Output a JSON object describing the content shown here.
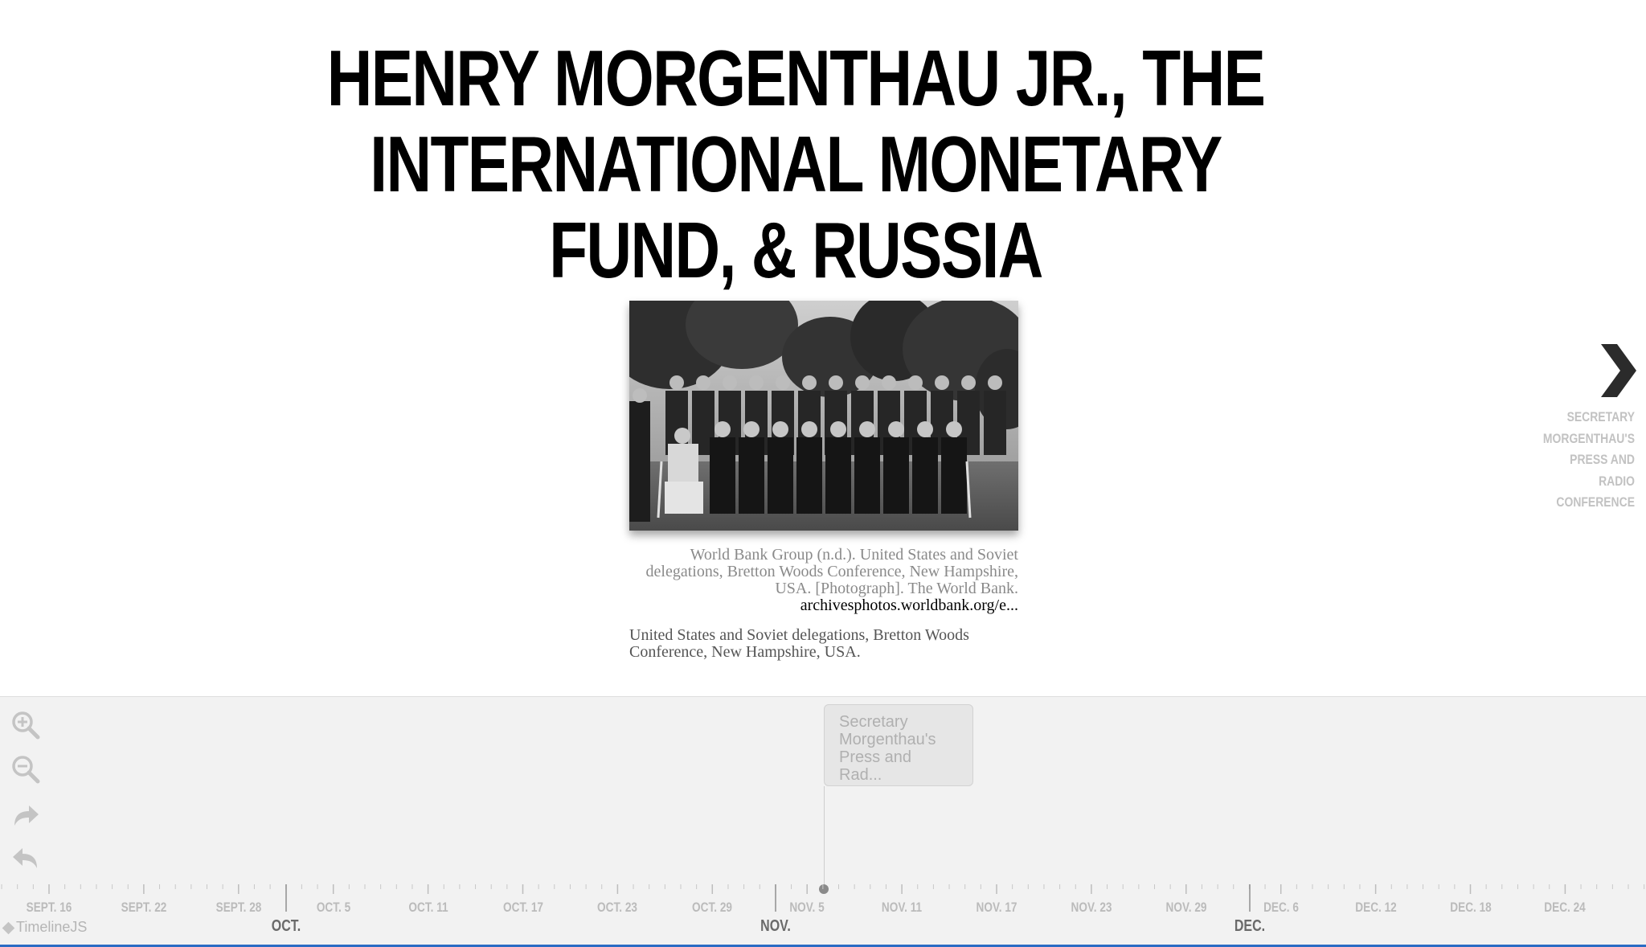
{
  "slide": {
    "title": "HENRY MORGENTHAU JR., THE INTERNATIONAL MONETARY FUND, & RUSSIA",
    "media_credit": "World Bank Group (n.d.). United States and Soviet delegations, Bretton Woods Conference, New Hampshire, USA. [Photograph]. The World Bank.",
    "media_link": "archivesphotos.worldbank.org/e...",
    "media_caption": "United States and Soviet delegations, Bretton Woods Conference, New Hampshire, USA."
  },
  "next_slide": {
    "icon": "chevron-right-icon",
    "label": "SECRETARY MORGENTHAU'S PRESS AND RADIO CONFERENCE"
  },
  "timeline": {
    "tools": [
      {
        "name": "zoom-in",
        "icon": "zoom-in-icon"
      },
      {
        "name": "zoom-out",
        "icon": "zoom-out-icon"
      },
      {
        "name": "forward",
        "icon": "redo-arrow-icon"
      },
      {
        "name": "back-to-start",
        "icon": "undo-arrow-icon"
      }
    ],
    "marker": {
      "text": "Secretary Morgenthau's Press and Rad..."
    },
    "minor_ticks": [
      "SEPT. 16",
      "SEPT. 22",
      "SEPT. 28",
      "OCT. 5",
      "OCT. 11",
      "OCT. 17",
      "OCT. 23",
      "OCT. 29",
      "NOV. 5",
      "NOV. 11",
      "NOV. 17",
      "NOV. 23",
      "NOV. 29",
      "DEC. 6",
      "DEC. 12",
      "DEC. 18",
      "DEC. 24"
    ],
    "major_ticks": [
      "OCT.",
      "NOV.",
      "DEC."
    ],
    "brand": "TimelineJS",
    "colors": {
      "accent_line": "#2b6cc4",
      "nav_background": "#f2f2f2"
    }
  }
}
